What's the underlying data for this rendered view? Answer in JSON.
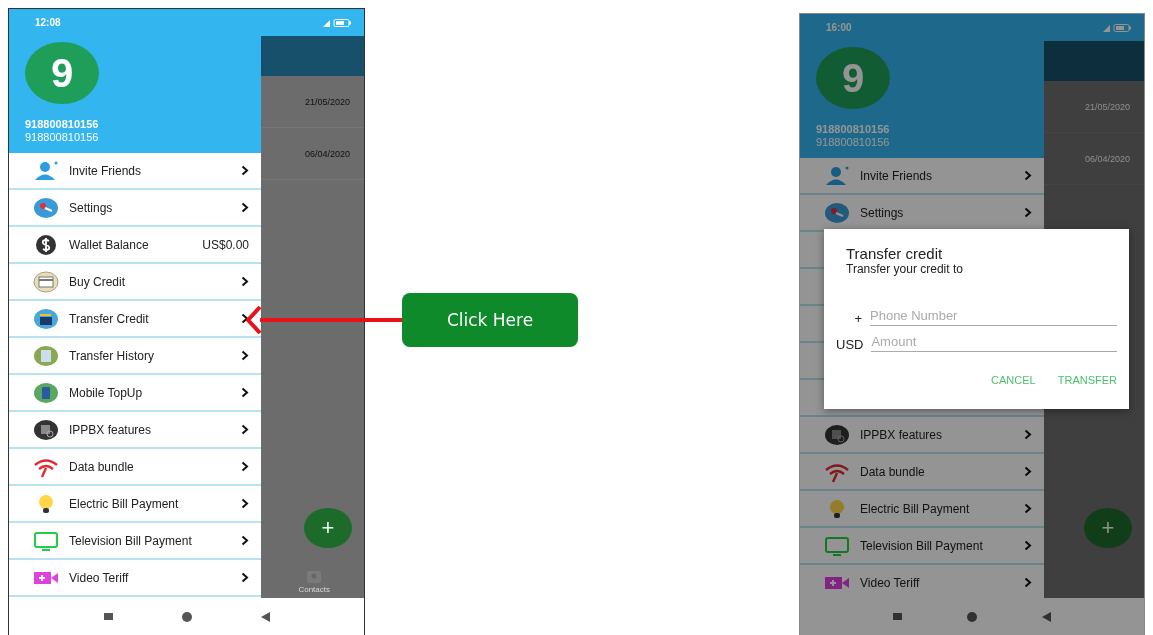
{
  "phones": [
    {
      "dimmed": false,
      "status_time": "12:08",
      "avatar": "9",
      "name": "918800810156",
      "number": "918800810156",
      "background_dates": [
        "21/05/2020",
        "06/04/2020"
      ],
      "background_label": "Contacts",
      "fab": "+",
      "menu": [
        {
          "kind": "link",
          "label": "Invite Friends"
        },
        {
          "kind": "link",
          "label": "Settings"
        },
        {
          "kind": "value",
          "label": "Wallet Balance",
          "value": "US$0.00"
        },
        {
          "kind": "link",
          "label": "Buy Credit"
        },
        {
          "kind": "link",
          "label": "Transfer Credit"
        },
        {
          "kind": "link",
          "label": "Transfer History"
        },
        {
          "kind": "link",
          "label": "Mobile TopUp"
        },
        {
          "kind": "link",
          "label": "IPPBX features"
        },
        {
          "kind": "link",
          "label": "Data bundle"
        },
        {
          "kind": "link",
          "label": "Electric Bill Payment"
        },
        {
          "kind": "link",
          "label": "Television Bill Payment"
        },
        {
          "kind": "link",
          "label": "Video Teriff"
        }
      ]
    },
    {
      "dimmed": true,
      "status_time": "16:00",
      "avatar": "9",
      "name": "918800810156",
      "number": "918800810156",
      "background_dates": [
        "21/05/2020",
        "06/04/2020"
      ],
      "fab": "+",
      "menu": [
        {
          "kind": "link",
          "label": "Invite Friends"
        },
        {
          "kind": "link",
          "label": "Settings"
        },
        {
          "kind": "covered"
        },
        {
          "kind": "covered"
        },
        {
          "kind": "covered"
        },
        {
          "kind": "covered"
        },
        {
          "kind": "covered"
        },
        {
          "kind": "link",
          "label": "IPPBX features"
        },
        {
          "kind": "link",
          "label": "Data bundle"
        },
        {
          "kind": "link",
          "label": "Electric Bill Payment"
        },
        {
          "kind": "link",
          "label": "Television Bill Payment"
        },
        {
          "kind": "link",
          "label": "Video Teriff"
        }
      ],
      "dialog": {
        "title": "Transfer credit",
        "subtitle": "Transfer your credit to",
        "fields": [
          {
            "prefix": "+",
            "placeholder": "Phone Number"
          },
          {
            "prefix": "USD",
            "placeholder": "Amount"
          }
        ],
        "buttons": [
          "CANCEL",
          "TRANSFER"
        ]
      }
    }
  ],
  "callout": {
    "label": "Click Here"
  }
}
